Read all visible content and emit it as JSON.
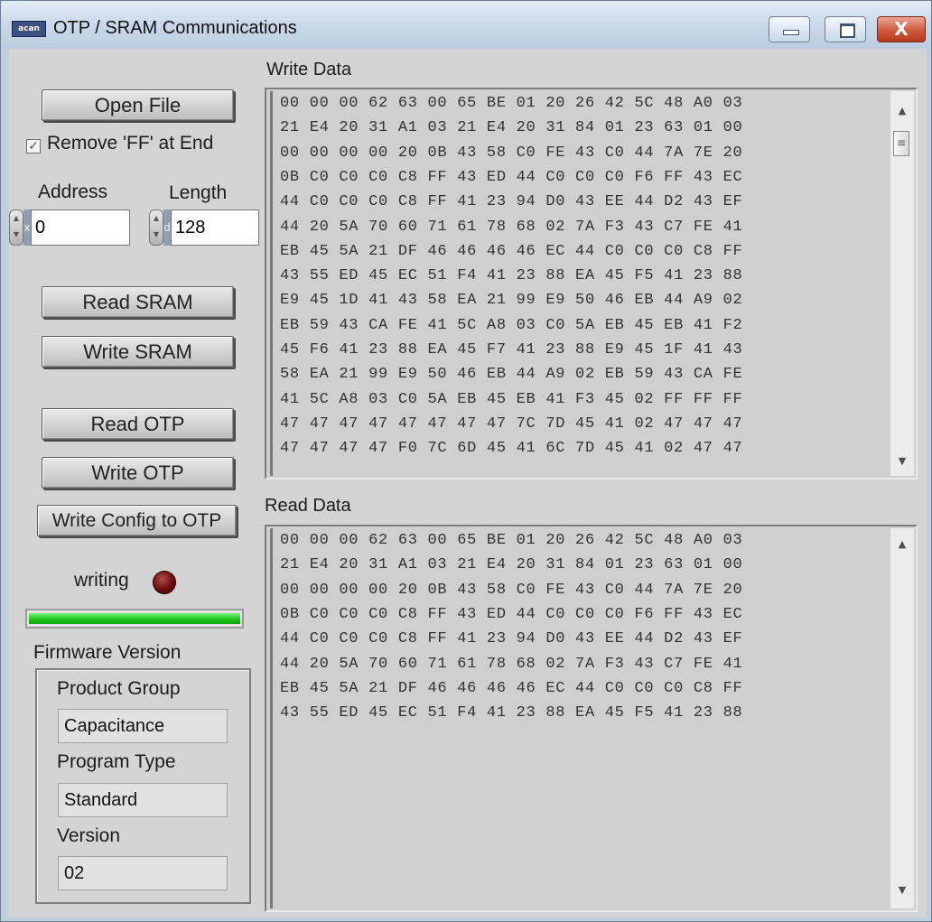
{
  "window": {
    "title": "OTP / SRAM Communications",
    "app_icon_label": "acan",
    "minimize_icon": "minimize-icon",
    "maximize_icon": "maximize-icon",
    "close_icon": "close-icon",
    "close_glyph": "X"
  },
  "controls": {
    "open_file_label": "Open File",
    "remove_ff_checked": true,
    "remove_ff_label": "Remove 'FF' at End",
    "address_label": "Address",
    "length_label": "Length",
    "address_radix": "x",
    "address_value": "0",
    "length_radix": "d",
    "length_value": "128",
    "read_sram_label": "Read SRAM",
    "write_sram_label": "Write SRAM",
    "read_otp_label": "Read OTP",
    "write_otp_label": "Write OTP",
    "write_config_label": "Write Config to OTP",
    "writing_label": "writing",
    "led_color": "#6e0c0c",
    "progress_fraction": 1.0,
    "progress_color": "#19c219"
  },
  "firmware": {
    "title": "Firmware Version",
    "product_group_label": "Product Group",
    "product_group_value": "Capacitance",
    "program_type_label": "Program Type",
    "program_type_value": "Standard",
    "version_label": "Version",
    "version_value": "02"
  },
  "write_data": {
    "label": "Write Data",
    "lines": [
      "00 00 00 62 63 00 65 BE 01 20 26 42 5C 48 A0 03",
      "21 E4 20 31 A1 03 21 E4 20 31 84 01 23 63 01 00",
      "00 00 00 00 20 0B 43 58 C0 FE 43 C0 44 7A 7E 20",
      "0B C0 C0 C0 C8 FF 43 ED 44 C0 C0 C0 F6 FF 43 EC",
      "44 C0 C0 C0 C8 FF 41 23 94 D0 43 EE 44 D2 43 EF",
      "44 20 5A 70 60 71 61 78 68 02 7A F3 43 C7 FE 41",
      "EB 45 5A 21 DF 46 46 46 46 EC 44 C0 C0 C0 C8 FF",
      "43 55 ED 45 EC 51 F4 41 23 88 EA 45 F5 41 23 88",
      "E9 45 1D 41 43 58 EA 21 99 E9 50 46 EB 44 A9 02",
      "EB 59 43 CA FE 41 5C A8 03 C0 5A EB 45 EB 41 F2",
      "45 F6 41 23 88 EA 45 F7 41 23 88 E9 45 1F 41 43",
      "58 EA 21 99 E9 50 46 EB 44 A9 02 EB 59 43 CA FE",
      "41 5C A8 03 C0 5A EB 45 EB 41 F3 45 02 FF FF FF",
      "47 47 47 47 47 47 47 47 7C 7D 45 41 02 47 47 47",
      "47 47 47 47 F0 7C 6D 45 41 6C 7D 45 41 02 47 47"
    ]
  },
  "read_data": {
    "label": "Read Data",
    "lines": [
      "00 00 00 62 63 00 65 BE 01 20 26 42 5C 48 A0 03",
      "21 E4 20 31 A1 03 21 E4 20 31 84 01 23 63 01 00",
      "00 00 00 00 20 0B 43 58 C0 FE 43 C0 44 7A 7E 20",
      "0B C0 C0 C0 C8 FF 43 ED 44 C0 C0 C0 F6 FF 43 EC",
      "44 C0 C0 C0 C8 FF 41 23 94 D0 43 EE 44 D2 43 EF",
      "44 20 5A 70 60 71 61 78 68 02 7A F3 43 C7 FE 41",
      "EB 45 5A 21 DF 46 46 46 46 EC 44 C0 C0 C0 C8 FF",
      "43 55 ED 45 EC 51 F4 41 23 88 EA 45 F5 41 23 88"
    ]
  },
  "scrollbar_icons": {
    "up": "up-arrow-icon",
    "down": "down-arrow-icon"
  }
}
